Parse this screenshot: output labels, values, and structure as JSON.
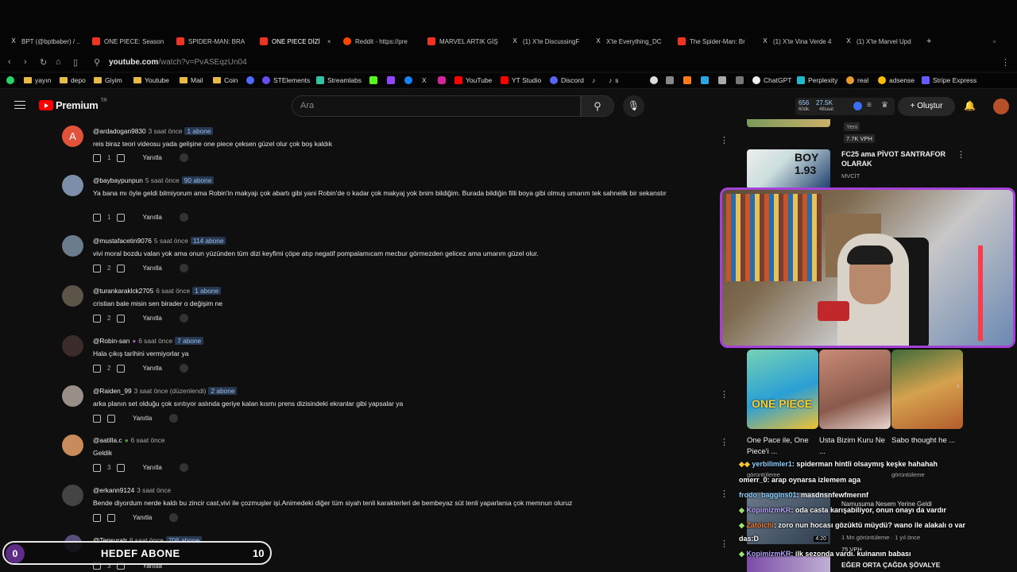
{
  "browser": {
    "tabs": [
      {
        "label": "BPT (@bptbaber) / ..",
        "icon": "x-icon"
      },
      {
        "label": "ONE PIECE: Season",
        "icon": "youtube-icon"
      },
      {
        "label": "SPIDER-MAN: BRA",
        "icon": "youtube-icon"
      },
      {
        "label": "ONE PIECE DİZİ",
        "icon": "youtube-icon",
        "close": "×"
      },
      {
        "label": "Reddit - https://pre",
        "icon": "reddit-icon"
      },
      {
        "label": "MARVEL ARTIK GİŞ",
        "icon": "youtube-icon"
      },
      {
        "label": "(1) X'te DiscussingF",
        "icon": "x-icon"
      },
      {
        "label": "X'te Everything_DC",
        "icon": "x-icon"
      },
      {
        "label": "The Spider-Man: Br",
        "icon": "youtube-icon"
      },
      {
        "label": "(1) X'te Vina Verde 4",
        "icon": "x-icon"
      },
      {
        "label": "(1) X'te Marvel Upd",
        "icon": "x-icon"
      }
    ],
    "new_tab": "+",
    "url_host": "youtube.com",
    "url_path": "/watch?v=PvASEqzUn04",
    "bookmarks": [
      "yayın",
      "depo",
      "Giyim",
      "Youtube",
      "Mail",
      "Coin",
      "STElements",
      "Streamlabs",
      "YouTube",
      "YT Studio",
      "Discord",
      "s",
      "ChatGPT",
      "Perplexity",
      "real",
      "adsense",
      "Stripe Express"
    ]
  },
  "youtube": {
    "logo": "Premium",
    "country": "TR",
    "search_placeholder": "Ara",
    "stats": {
      "a": "656",
      "a_sub": "60dk.",
      "b": "27.5K",
      "b_sub": "48saat"
    },
    "create_label": "Oluştur"
  },
  "comments": [
    {
      "user": "@ardadogan9830",
      "time": "3 saat önce",
      "badge": "1 abone",
      "text": "reis biraz teori videosu yada gelişine one piece çeksen güzel olur çok boş kaldık",
      "likes": "1",
      "reply": "Yanıtla",
      "avatar_letter": "A"
    },
    {
      "user": "@baybaypunpun",
      "time": "5 saat önce",
      "badge": "90 abone",
      "text": "Ya bana mı öyle geldi bilmiyorum ama Robin'in makyajı çok abartı gibi yani Robin'de o kadar çok makyaj yok bnim bildiğim. Burada bildiğin filli boya gibi olmuş umarım tek sahnelik bir sekanstır",
      "likes": "1",
      "reply": "Yanıtla"
    },
    {
      "user": "@mustafacetin9076",
      "time": "5 saat önce",
      "badge": "114 abone",
      "text": "vivi moral bozdu valan yok ama onun yüzünden tüm dizi keyfimi çöpe atıp negatif pompalamıcam mecbur görmezden gelicez ama umarım güzel olur.",
      "likes": "2",
      "reply": "Yanıtla"
    },
    {
      "user": "@turankaraklck2705",
      "time": "6 saat önce",
      "badge": "1 abone",
      "text": "cristian bale misin sen birader o değişim ne",
      "likes": "2",
      "reply": "Yanıtla"
    },
    {
      "user": "@Robin-san",
      "time": "6 saat önce",
      "badge": "7 abone",
      "text": "Hala çıkış tarihini vermiyorlar ya",
      "likes": "2",
      "reply": "Yanıtla"
    },
    {
      "user": "@Raiden_99",
      "time": "3 saat önce (düzenlendi)",
      "badge": "2 abone",
      "text": "arka planın set olduğu çok sırıtıyor aslında geriye kalan kısmı prens dizisindeki ekranlar gibi yapsalar ya",
      "likes": "",
      "reply": "Yanıtla"
    },
    {
      "user": "@aatilla.c",
      "time": "6 saat önce",
      "badge": "",
      "text": "Geldik",
      "likes": "3",
      "reply": "Yanıtla"
    },
    {
      "user": "@erkann9124",
      "time": "3 saat önce",
      "badge": "",
      "text": "Bende diyordum nerde kaldı bu zincir cast,vivi ile çozmuşler işi.Animedeki diğer tüm siyah tenli karakterleri de bembeyaz süt tenli yaparlarsa çok memnun oluruz",
      "likes": "",
      "reply": "Yanıtla"
    },
    {
      "user": "@Tepsuratr",
      "time": "6 saat önce",
      "badge": "706 abone",
      "text": "",
      "likes": "3",
      "reply": "Yanıtla"
    }
  ],
  "sidebar": {
    "top_badge": "Yeni",
    "top_views": "7.7K VPH",
    "rec": {
      "title": "FC25 ama PİVOT SANTRAFOR OLARAK",
      "channel": "MVCİT",
      "thumb_text": "BOY 1.93"
    },
    "shorts": [
      {
        "title": "One Pace ile, One Piece'i ...",
        "views": "görüntüleme"
      },
      {
        "title": "Usta Bizim Kuru Ne ...",
        "views": ""
      },
      {
        "title": "Sabo thought he ...",
        "views": "görüntüleme"
      }
    ],
    "under": [
      {
        "title": "Namusuma Nesem Yerine Geldi",
        "meta": "1 Mn görüntüleme · 1 yıl önce"
      },
      {
        "title": "EĞER ORTA ÇAĞDA ŞÖVALYE",
        "meta": "75 VPH"
      }
    ],
    "thumb_time": "4:20"
  },
  "chat": [
    {
      "user": "yerbilimler1",
      "msg": ": spiderman hintli olsaymış keşke hahahah"
    },
    {
      "user": "görüntüleme",
      "msg": ""
    },
    {
      "user": "omerr_0",
      "msg": ": arap oynarsa izlemem aga"
    },
    {
      "user": "frodo_baggins01",
      "msg": ": masdnsnfewfmerınf"
    },
    {
      "user": "KopimizmKR",
      "msg": ": oda casta karışabiliyor, onun onayı da vardır"
    },
    {
      "user": "Zatoichi",
      "msg": ": zoro nun hocası gözüktü müydü? wano ile alakalı o var"
    },
    {
      "user": "das:D",
      "msg": ""
    },
    {
      "user": "KopimizmKR",
      "msg": ": ilk sezonda vardı. kuinanın babası"
    }
  ],
  "goal": {
    "current": "0",
    "label": "HEDEF ABONE",
    "target": "10",
    "accent": "#5d2c86"
  }
}
